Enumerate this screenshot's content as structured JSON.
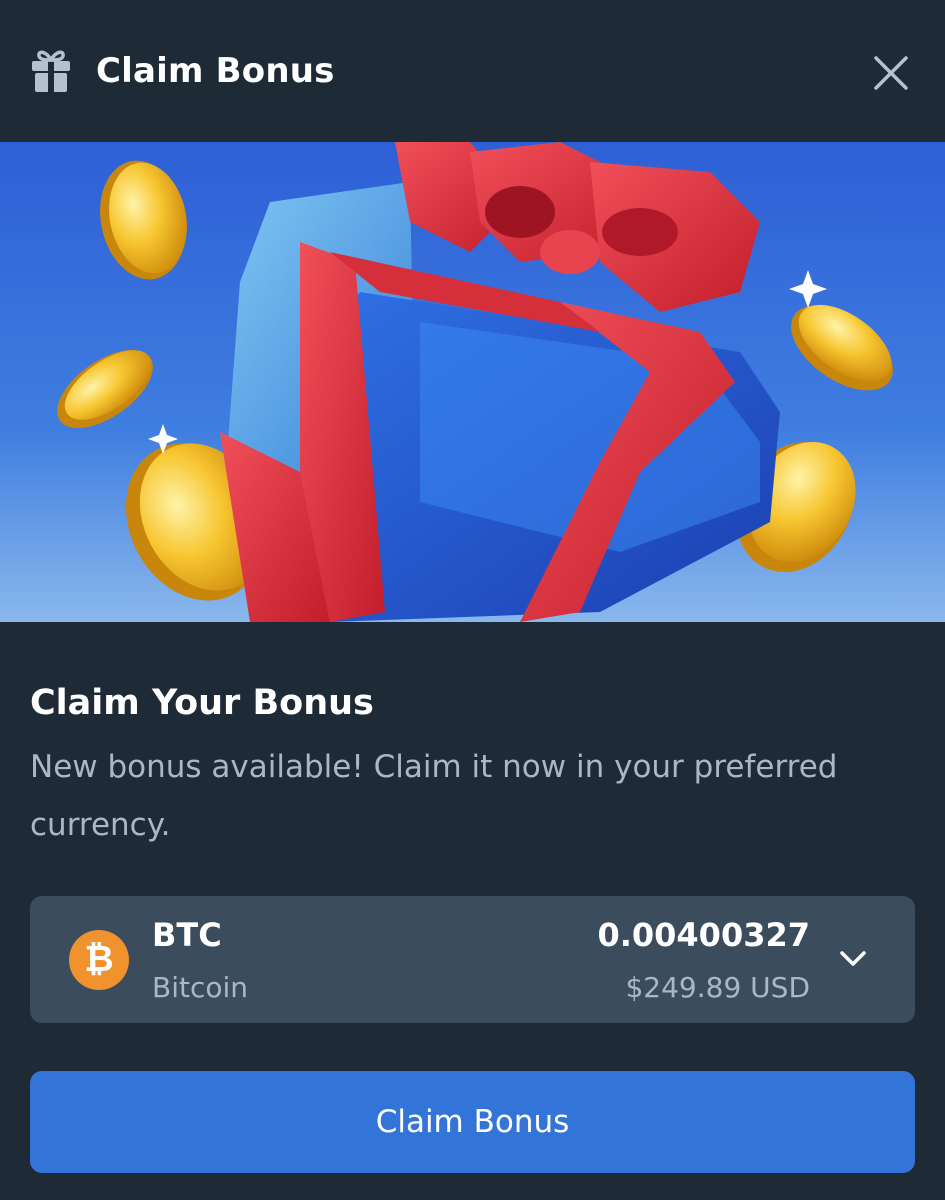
{
  "header": {
    "title": "Claim Bonus",
    "icon": "gift-icon",
    "close_icon": "close-icon"
  },
  "banner": {
    "image": "gift box with coins illustration"
  },
  "content": {
    "title": "Claim Your Bonus",
    "description": "New bonus available! Claim it now in your preferred currency."
  },
  "currency": {
    "icon_symbol": "₿",
    "code": "BTC",
    "name": "Bitcoin",
    "amount": "0.00400327",
    "usd_value": "$249.89 USD",
    "dropdown_icon": "chevron-down-icon"
  },
  "actions": {
    "claim_label": "Claim Bonus"
  },
  "colors": {
    "background": "#1e2a36",
    "select_background": "#3b4d5d",
    "accent": "#3374d8",
    "bitcoin": "#f0922d",
    "muted_text": "#a9b7c6"
  }
}
